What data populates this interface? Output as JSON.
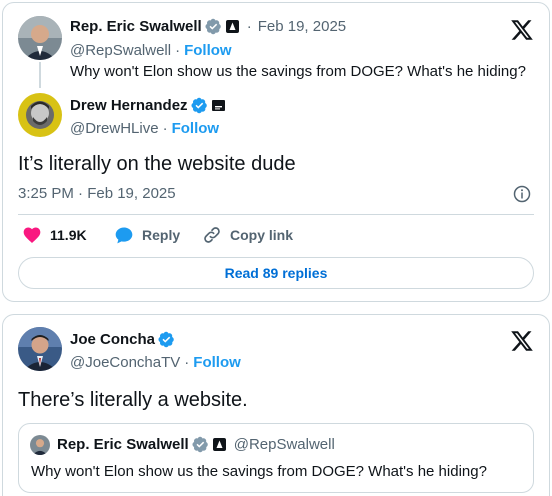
{
  "tweet1": {
    "parent": {
      "name": "Rep. Eric Swalwell",
      "date_sep": "·",
      "date": "Feb 19, 2025",
      "handle": "@RepSwalwell",
      "follow_sep": "·",
      "follow_label": "Follow",
      "text": "Why won't Elon show us the savings from DOGE? What's he hiding?"
    },
    "reply": {
      "name": "Drew Hernandez",
      "handle": "@DrewHLive",
      "follow_sep": "·",
      "follow_label": "Follow",
      "text": "It’s literally on the website dude",
      "timestamp": "3:25 PM · Feb 19, 2025"
    },
    "actions": {
      "likes": "11.9K",
      "reply_label": "Reply",
      "copy_link_label": "Copy link"
    },
    "read_replies_label": "Read 89 replies"
  },
  "tweet2": {
    "name": "Joe Concha",
    "handle": "@JoeConchaTV",
    "follow_sep": "·",
    "follow_label": "Follow",
    "text": "There’s literally a website.",
    "quote": {
      "name": "Rep. Eric Swalwell",
      "handle": "@RepSwalwell",
      "text": "Why won't Elon show us the savings from DOGE? What's he hiding?"
    }
  },
  "colors": {
    "accent": "#1d9bf0",
    "like": "#f91880",
    "verified_gray": "#829aab",
    "verified_blue": "#1d9bf0"
  }
}
